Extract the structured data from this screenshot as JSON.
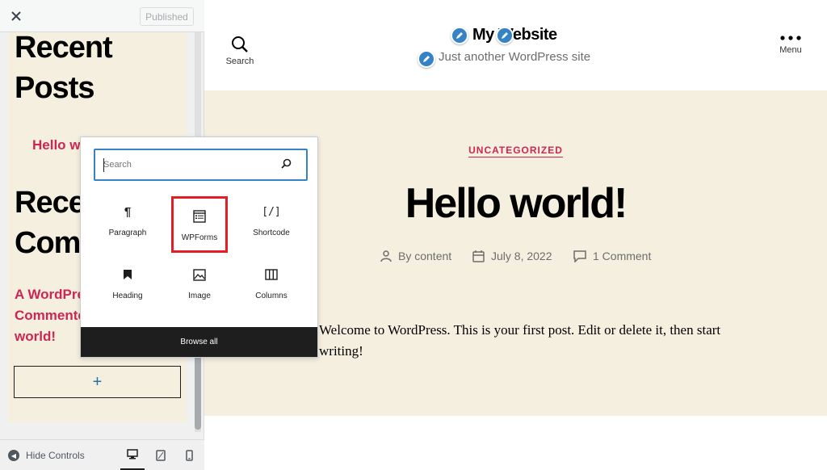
{
  "panel": {
    "published_label": "Published",
    "close_icon": "close-icon",
    "recent_posts_title": "Recent Posts",
    "recent_posts_link": "Hello world!",
    "recent_comments_title": "Recent Comments",
    "recent_comment_text": "A WordPress Commenter on Hello world!",
    "add_block_label": "+",
    "hide_controls_label": "Hide Controls"
  },
  "site": {
    "title": "My Website",
    "tagline": "Just another WordPress site",
    "search_label": "Search",
    "menu_label": "Menu"
  },
  "post": {
    "category": "UNCATEGORIZED",
    "title": "Hello world!",
    "author": "By content",
    "date": "July 8, 2022",
    "comments": "1 Comment",
    "body": "Welcome to WordPress. This is your first post. Edit or delete it, then start writing!"
  },
  "inserter": {
    "search_placeholder": "Search",
    "blocks": [
      {
        "label": "Paragraph",
        "icon": "paragraph-icon"
      },
      {
        "label": "WPForms",
        "icon": "wpforms-icon"
      },
      {
        "label": "Shortcode",
        "icon": "shortcode-icon"
      },
      {
        "label": "Heading",
        "icon": "heading-icon"
      },
      {
        "label": "Image",
        "icon": "image-icon"
      },
      {
        "label": "Columns",
        "icon": "columns-icon"
      }
    ],
    "browse_all_label": "Browse all"
  },
  "colors": {
    "accent": "#cd2653",
    "content_bg": "#f5efe0",
    "highlight": "#e31e24",
    "focus": "#3582c4"
  }
}
